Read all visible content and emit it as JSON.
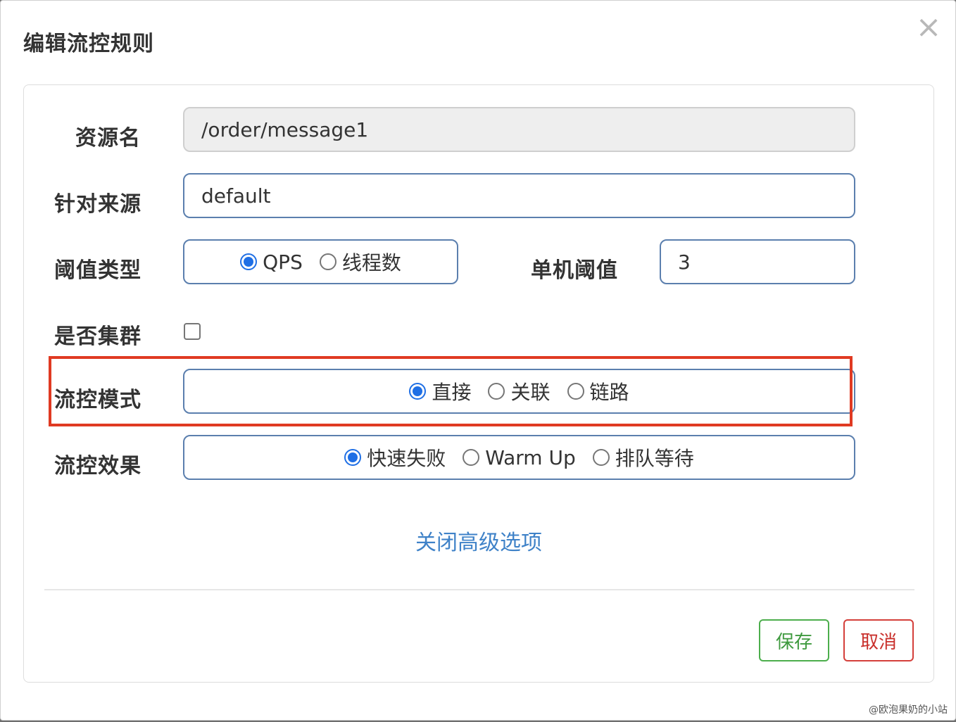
{
  "dialog": {
    "title": "编辑流控规则",
    "close_glyph": "×"
  },
  "form": {
    "resource_name": {
      "label": "资源名",
      "value": "/order/message1"
    },
    "limit_app": {
      "label": "针对来源",
      "value": "default"
    },
    "threshold_type": {
      "label": "阈值类型",
      "options": [
        "QPS",
        "线程数"
      ],
      "selected": "QPS"
    },
    "threshold": {
      "label": "单机阈值",
      "value": "3"
    },
    "cluster": {
      "label": "是否集群",
      "checked": false
    },
    "control_mode": {
      "label": "流控模式",
      "options": [
        "直接",
        "关联",
        "链路"
      ],
      "selected": "直接"
    },
    "control_effect": {
      "label": "流控效果",
      "options": [
        "快速失败",
        "Warm Up",
        "排队等待"
      ],
      "selected": "快速失败"
    }
  },
  "advanced_toggle": "关闭高级选项",
  "buttons": {
    "save": "保存",
    "cancel": "取消"
  },
  "watermark": "@欧泡果奶的小站",
  "colors": {
    "accent": "#1f6fe5",
    "link": "#3f82c8",
    "save": "#4cae4c",
    "cancel": "#d43f3a",
    "highlight": "#e03a22"
  }
}
